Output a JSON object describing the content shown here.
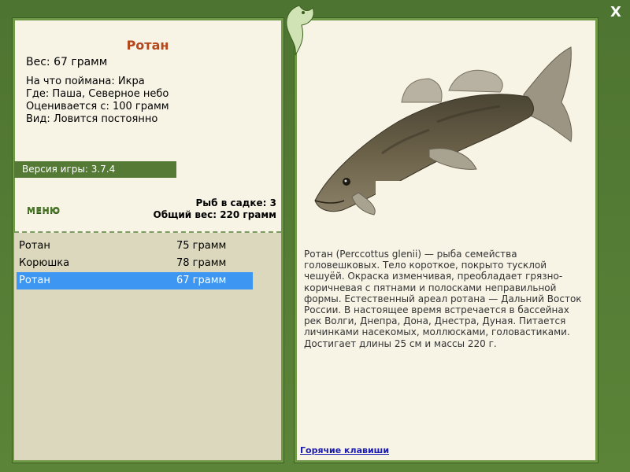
{
  "fish": {
    "name": "Ротан",
    "weight": "Вес: 67 грамм",
    "caught_on": "На что поймана: Икра",
    "location": "Где: Паша, Северное небо",
    "valued_from": "Оценивается с: 100 грамм",
    "type": "Вид: Ловится постоянно"
  },
  "version": "Версия игры: 3.7.4",
  "menu_label": "МЕНЮ",
  "stats": {
    "count": "Рыб в садке: 3",
    "total": "Общий вес: 220 грамм"
  },
  "fish_list": [
    {
      "name": "Ротан",
      "weight": "75 грамм",
      "selected": false
    },
    {
      "name": "Корюшка",
      "weight": "78 грамм",
      "selected": false
    },
    {
      "name": "Ротан",
      "weight": "67 грамм",
      "selected": true
    }
  ],
  "description": "Ротан (Perccottus glenii) — рыба семейства головешковых. Тело короткое, покрыто тусклой чешуёй. Окраска изменчивая, преобладает грязно-коричневая с пятнами и полосками неправильной формы. Естественный ареал ротана — Дальний Восток России. В настоящее время встречается в бассейнах рек Волги, Днепра, Дона, Днестра, Дуная. Питается личинками насекомых, моллюсками, головастиками. Достигает длины 25 см и массы 220 г.",
  "hotkeys_label": "Горячие клавиши",
  "close_label": "X",
  "colors": {
    "frame": "#557a35",
    "panel": "#f7f4e6",
    "title": "#b5461a",
    "selection": "#3d96f2"
  }
}
